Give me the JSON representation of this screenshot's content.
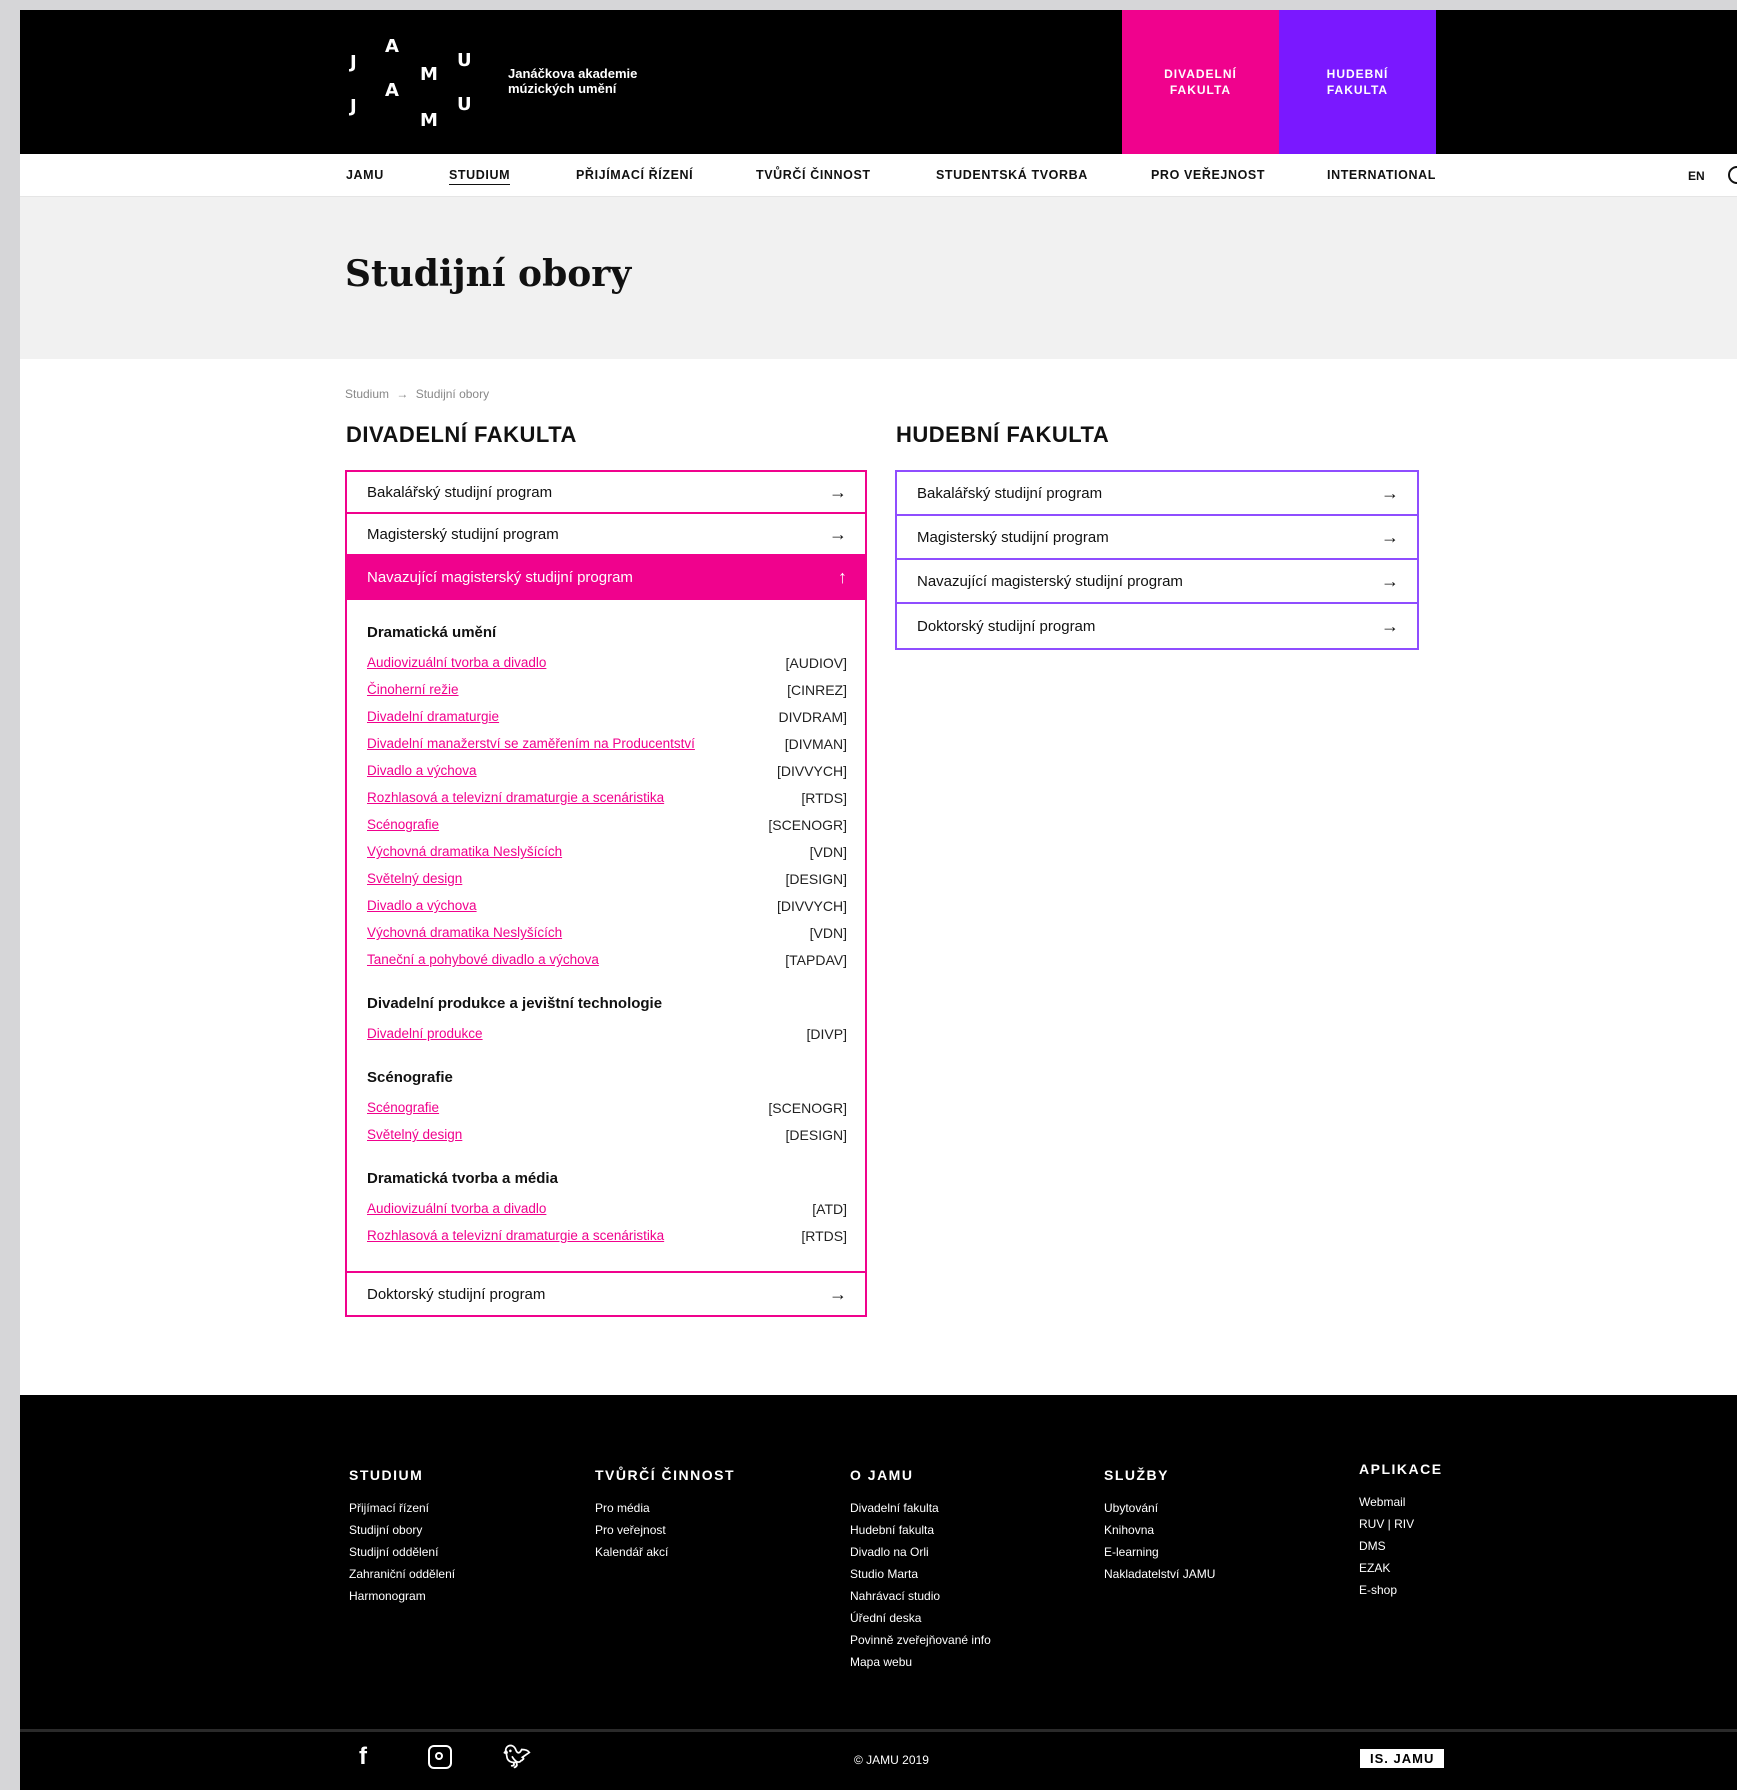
{
  "header": {
    "logo_letters": [
      "J",
      "A",
      "M",
      "U",
      "J",
      "A",
      "M",
      "U"
    ],
    "logo_subtitle": "Janáčkova akademie múzických umění",
    "tabs": [
      {
        "label": "DIVADELNÍ FAKULTA",
        "color": "#f0028d"
      },
      {
        "label": "HUDEBNÍ FAKULTA",
        "color": "#7a18ff"
      }
    ]
  },
  "nav": {
    "items": [
      "JAMU",
      "STUDIUM",
      "PŘIJÍMACÍ ŘÍZENÍ",
      "TVŮRČÍ ČINNOST",
      "STUDENTSKÁ TVORBA",
      "PRO VEŘEJNOST",
      "INTERNATIONAL"
    ],
    "active": "STUDIUM",
    "lang": "EN",
    "search_icon": "search-icon"
  },
  "page_title": "Studijní obory",
  "breadcrumb": [
    "Studium",
    "→",
    "Studijní obory"
  ],
  "divadelni": {
    "title": "DIVADELNÍ FAKULTA",
    "rows": {
      "bc": "Bakalářský studijní program",
      "mgr": "Magisterský studijní program",
      "nmgr": "Navazující magisterský studijní program",
      "dr": "Doktorský studijní program"
    },
    "arrow": "→",
    "up_arrow": "↑",
    "groups": [
      {
        "title": "Dramatická umění",
        "programs": [
          {
            "name": "Audiovizuální tvorba a divadlo",
            "code": "[AUDIOV]"
          },
          {
            "name": "Činoherní režie",
            "code": "[CINREZ]"
          },
          {
            "name": "Divadelní dramaturgie",
            "code": "DIVDRAM]"
          },
          {
            "name": "Divadelní manažerství se zaměřením na Producentství",
            "code": "[DIVMAN]"
          },
          {
            "name": "Divadlo a výchova",
            "code": "[DIVVYCH]"
          },
          {
            "name": "Rozhlasová a televizní dramaturgie a scenáristika",
            "code": "[RTDS]"
          },
          {
            "name": "Scénografie",
            "code": "[SCENOGR]"
          },
          {
            "name": "Výchovná dramatika Neslyšících",
            "code": "[VDN]"
          },
          {
            "name": "Světelný design",
            "code": "[DESIGN]"
          },
          {
            "name": "Divadlo a výchova",
            "code": "[DIVVYCH]"
          },
          {
            "name": "Výchovná dramatika Neslyšících",
            "code": "[VDN]"
          },
          {
            "name": "Taneční a pohybové divadlo a výchova",
            "code": "[TAPDAV]"
          }
        ]
      },
      {
        "title": "Divadelní produkce a jevištní technologie",
        "programs": [
          {
            "name": "Divadelní produkce",
            "code": "[DIVP]"
          }
        ]
      },
      {
        "title": "Scénografie",
        "programs": [
          {
            "name": "Scénografie",
            "code": "[SCENOGR]"
          },
          {
            "name": "Světelný design",
            "code": "[DESIGN]"
          }
        ]
      },
      {
        "title": "Dramatická tvorba a média",
        "programs": [
          {
            "name": "Audiovizuální tvorba a divadlo",
            "code": "[ATD]"
          },
          {
            "name": "Rozhlasová a televizní dramaturgie a scenáristika",
            "code": "[RTDS]"
          }
        ]
      }
    ]
  },
  "hudebni": {
    "title": "HUDEBNÍ FAKULTA",
    "rows": [
      "Bakalářský studijní program",
      "Magisterský studijní program",
      "Navazující magisterský studijní program",
      "Doktorský studijní program"
    ]
  },
  "footer": {
    "columns": [
      {
        "title": "STUDIUM",
        "links": [
          "Přijímací řízení",
          "Studijní obory",
          "Studijní oddělení",
          "Zahraniční oddělení",
          "Harmonogram"
        ]
      },
      {
        "title": "TVŮRČÍ ČINNOST",
        "links": [
          "Pro média",
          "Pro veřejnost",
          "Kalendář akcí"
        ]
      },
      {
        "title": "O JAMU",
        "links": [
          "Divadelní fakulta",
          "Hudební fakulta",
          "Divadlo na Orli",
          "Studio Marta",
          "Nahrávací studio",
          "Úřední deska",
          "Povinně zveřejňované info",
          "Mapa webu"
        ]
      },
      {
        "title": "SLUŽBY",
        "links": [
          "Ubytování",
          "Knihovna",
          "E-learning",
          "Nakladatelství JAMU"
        ]
      },
      {
        "title": "APLIKACE",
        "links": [
          "Webmail",
          "RUV | RIV",
          "DMS",
          "EZAK",
          "E-shop"
        ]
      }
    ],
    "social": [
      "facebook-icon",
      "instagram-icon",
      "twitter-icon"
    ],
    "copyright": "© JAMU 2019",
    "badge": "IS. JAMU"
  }
}
